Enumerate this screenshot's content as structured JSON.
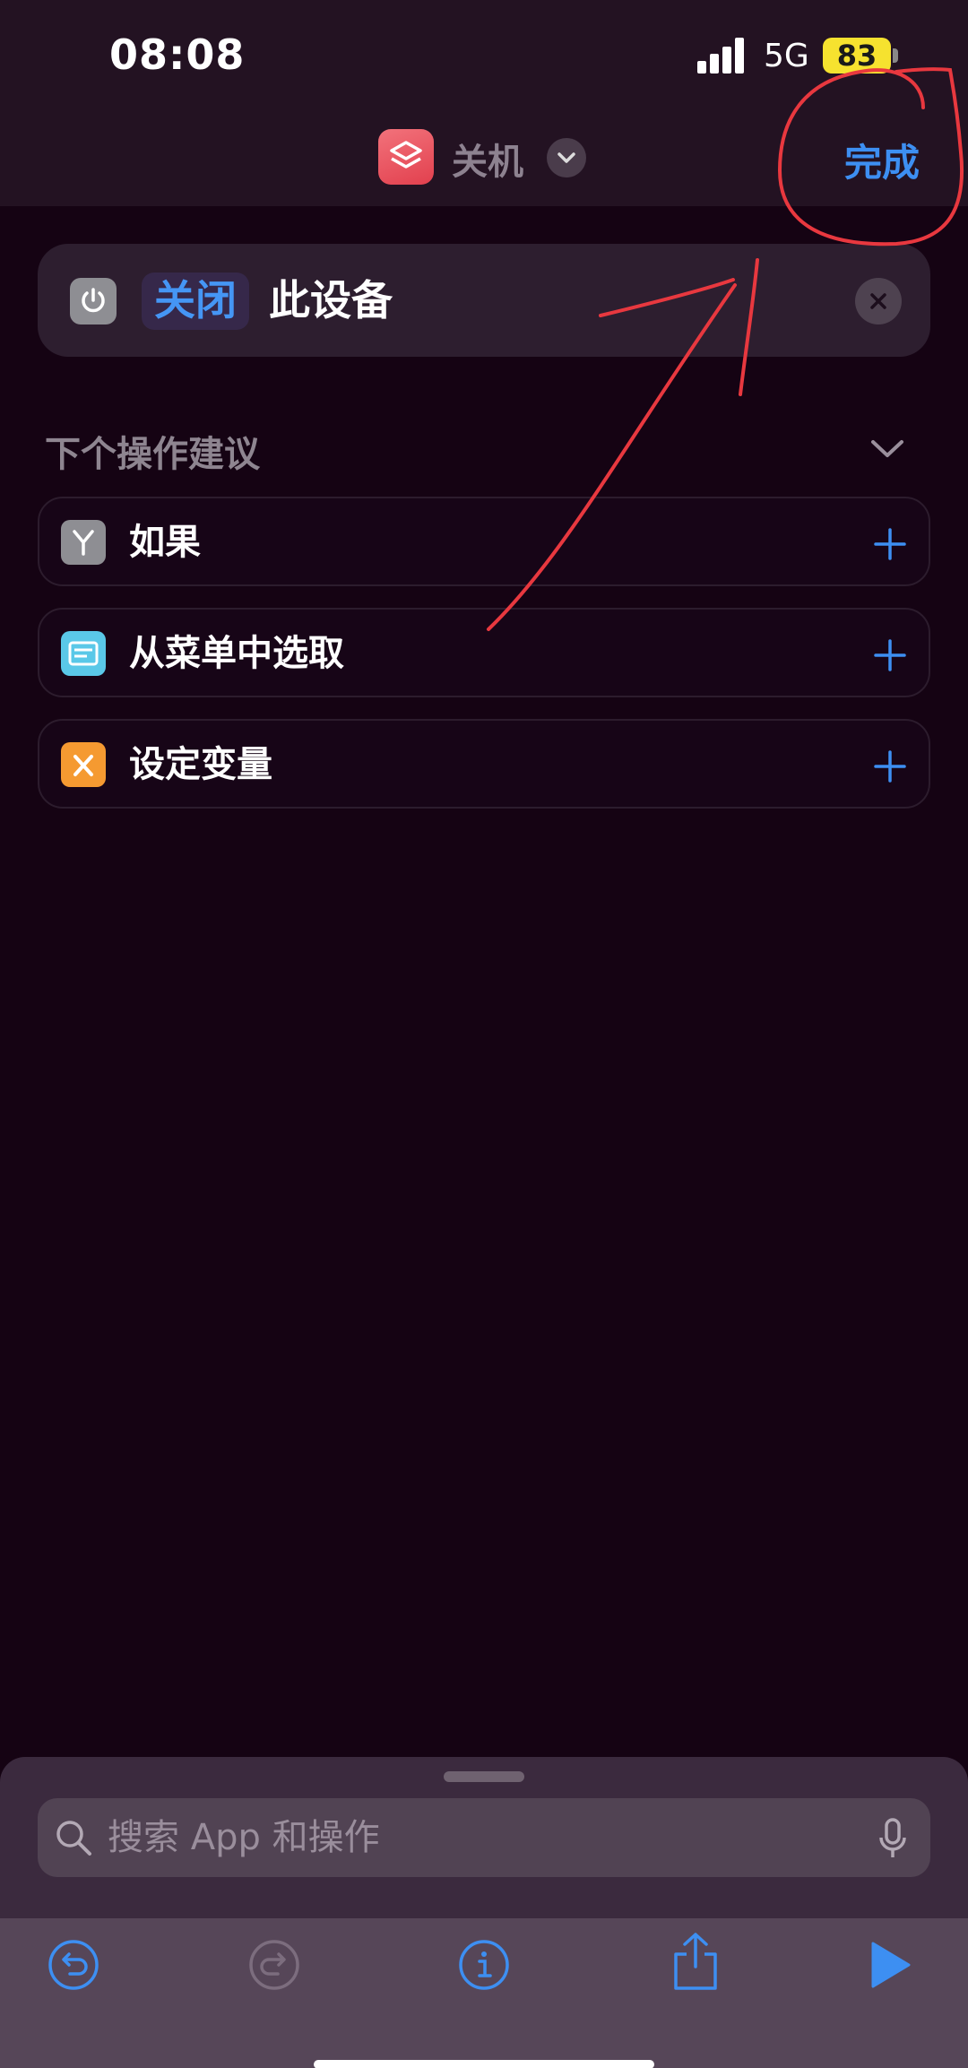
{
  "status_bar": {
    "time": "08:08",
    "network": "5G",
    "battery": "83"
  },
  "header": {
    "shortcut_name": "关机",
    "done_label": "完成"
  },
  "action": {
    "token": "关闭",
    "text": "此设备"
  },
  "suggestions": {
    "title": "下个操作建议",
    "items": [
      {
        "label": "如果",
        "icon": "branch-icon",
        "color": "#8e8e93"
      },
      {
        "label": "从菜单中选取",
        "icon": "menu-icon",
        "color": "#5ac8e8"
      },
      {
        "label": "设定变量",
        "icon": "variable-icon",
        "color": "#f59a31"
      }
    ]
  },
  "search": {
    "placeholder": "搜索 App 和操作"
  },
  "colors": {
    "accent": "#3d8ff2",
    "background": "#150313",
    "annotation": "#e8383f"
  }
}
